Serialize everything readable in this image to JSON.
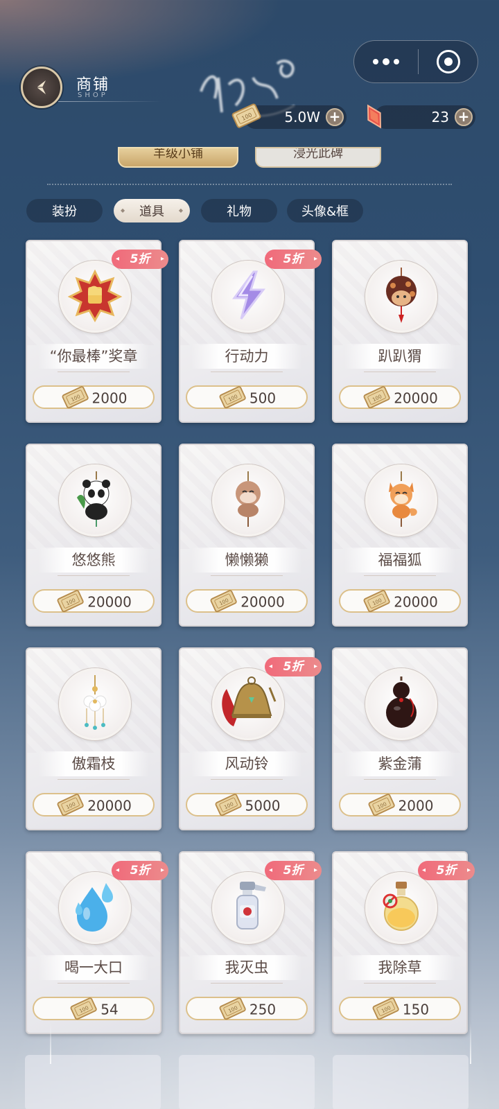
{
  "header": {
    "title": "商铺",
    "subtitle": "SHOP",
    "back_icon": "back-arrow-icon"
  },
  "capsule": {
    "more_icon": "more-dots-icon",
    "close_icon": "target-close-icon"
  },
  "currencies": [
    {
      "name": "ticket",
      "value": "5.0W",
      "icon": "ticket-icon"
    },
    {
      "name": "gem",
      "value": "23",
      "icon": "red-gem-icon"
    }
  ],
  "top_tabs": [
    "羊级小铺",
    "浸光此碑"
  ],
  "categories": [
    {
      "label": "装扮",
      "active": false
    },
    {
      "label": "道具",
      "active": true
    },
    {
      "label": "礼物",
      "active": false
    },
    {
      "label": "头像&框",
      "active": false
    }
  ],
  "discount_label": "5折",
  "items": [
    {
      "name": "“你最棒”奖章",
      "price": "2000",
      "discount": true,
      "icon": "medal-icon"
    },
    {
      "name": "行动力",
      "price": "500",
      "discount": true,
      "icon": "lightning-icon"
    },
    {
      "name": "趴趴猬",
      "price": "20000",
      "discount": false,
      "icon": "hedgehog-charm-icon"
    },
    {
      "name": "悠悠熊",
      "price": "20000",
      "discount": false,
      "icon": "panda-charm-icon"
    },
    {
      "name": "懒懒獭",
      "price": "20000",
      "discount": false,
      "icon": "otter-charm-icon"
    },
    {
      "name": "福福狐",
      "price": "20000",
      "discount": false,
      "icon": "fox-charm-icon"
    },
    {
      "name": "傲霜枝",
      "price": "20000",
      "discount": false,
      "icon": "flower-pendant-icon"
    },
    {
      "name": "风动铃",
      "price": "5000",
      "discount": true,
      "icon": "bell-icon"
    },
    {
      "name": "紫金蒲",
      "price": "2000",
      "discount": false,
      "icon": "gourd-icon"
    },
    {
      "name": "喝一大口",
      "price": "54",
      "discount": true,
      "icon": "water-drop-icon"
    },
    {
      "name": "我灭虫",
      "price": "250",
      "discount": true,
      "icon": "spray-bottle-icon"
    },
    {
      "name": "我除草",
      "price": "150",
      "discount": true,
      "icon": "potion-bottle-icon"
    }
  ]
}
